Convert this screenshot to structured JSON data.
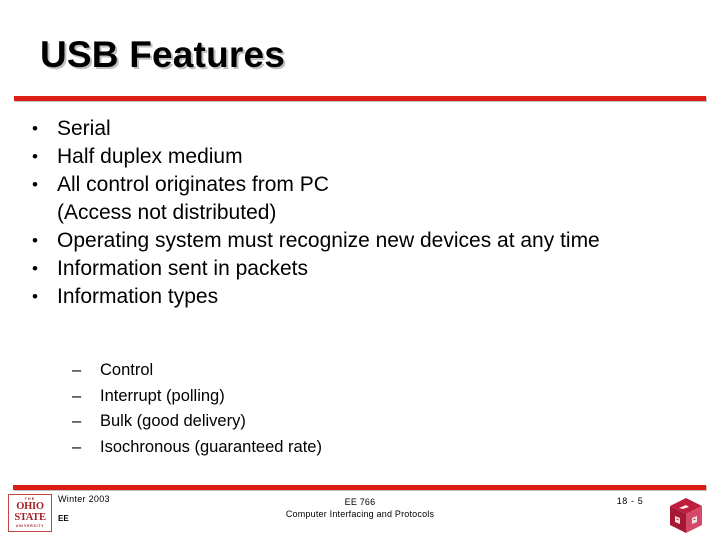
{
  "slide": {
    "title": "USB Features",
    "accent_color": "#DD1C16",
    "bullets": [
      {
        "marker": "•",
        "text": "Serial"
      },
      {
        "marker": "•",
        "text": "Half duplex medium"
      },
      {
        "marker": "•",
        "text": "All control originates from PC (Access not distributed)"
      },
      {
        "marker": "•",
        "text": "Operating system must recognize new devices at any time"
      },
      {
        "marker": "•",
        "text": "Information sent in packets"
      },
      {
        "marker": "•",
        "text": "Information types"
      }
    ],
    "sub_bullets": [
      {
        "marker": "–",
        "text": "Control"
      },
      {
        "marker": "–",
        "text": "Interrupt (polling)"
      },
      {
        "marker": "–",
        "text": "Bulk (good delivery)"
      },
      {
        "marker": "–",
        "text": "Isochronous (guaranteed rate)"
      }
    ]
  },
  "footer": {
    "date": "Winter 2003",
    "department": "EE",
    "course_code": "EE 766",
    "course_title": "Computer Interfacing and Protocols",
    "page_number": "18 -  5",
    "logo": {
      "line1": "THE",
      "line2": "OHIO",
      "line3": "STATE",
      "line4": "UNIVERSITY",
      "color": "#A81F24"
    },
    "cube_logo_color": "#BE1E3C"
  }
}
